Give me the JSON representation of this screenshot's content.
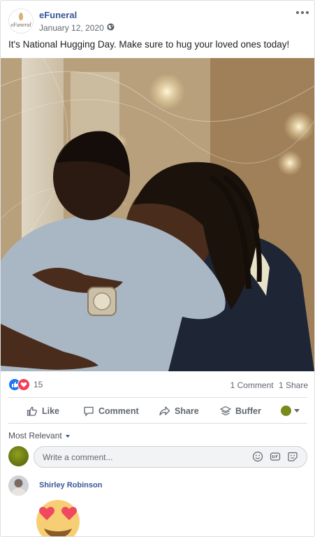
{
  "post": {
    "page_name": "eFuneral",
    "avatar_text": "eFuneral",
    "date": "January 12, 2020 ·",
    "text": "It's National Hugging Day. Make sure to hug your loved ones today!",
    "photo_icon": "photo-two-men-hugging"
  },
  "reactions": {
    "count": "15",
    "icons": [
      "like-icon",
      "love-icon"
    ],
    "comments": "1 Comment",
    "shares": "1 Share"
  },
  "actions": {
    "like": "Like",
    "comment": "Comment",
    "share": "Share",
    "buffer": "Buffer"
  },
  "comments": {
    "sort_label": "Most Relevant",
    "placeholder": "Write a comment...",
    "items": [
      {
        "author": "Shirley Robinson",
        "content_icon": "heart-eyes-emoji"
      }
    ]
  },
  "colors": {
    "link": "#385898",
    "like": "#1877f2",
    "love": "#f33e58",
    "muted": "#606770"
  }
}
